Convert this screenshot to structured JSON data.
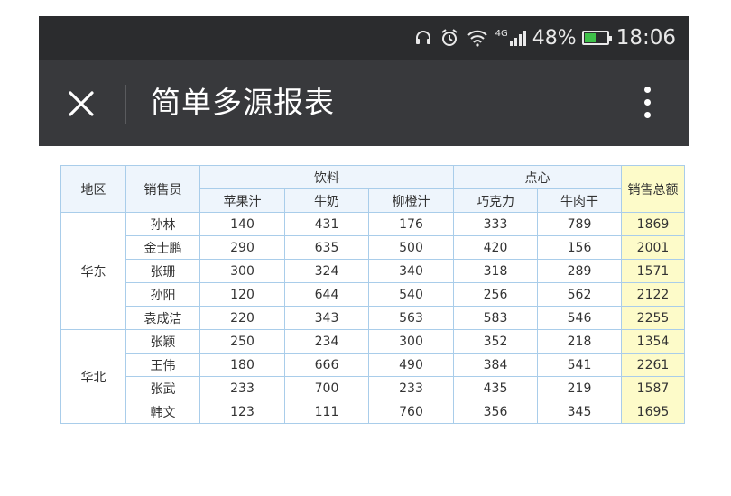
{
  "status_bar": {
    "battery_percent": "48%",
    "battery_level": 0.48,
    "network_label": "4G",
    "time": "18:06",
    "battery_color": "#3fc14a"
  },
  "app_bar": {
    "title": "简单多源报表",
    "close_icon": "close-icon",
    "more_icon": "more-vertical-icon"
  },
  "report": {
    "headers": {
      "region": "地区",
      "salesperson": "销售员",
      "group_drinks": "饮料",
      "group_snacks": "点心",
      "total": "销售总额",
      "drinks": [
        "苹果汁",
        "牛奶",
        "柳橙汁"
      ],
      "snacks": [
        "巧克力",
        "牛肉干"
      ]
    },
    "regions": [
      {
        "name": "华东",
        "rows": [
          {
            "person": "孙林",
            "values": [
              140,
              431,
              176,
              333,
              789
            ],
            "total": 1869
          },
          {
            "person": "金士鹏",
            "values": [
              290,
              635,
              500,
              420,
              156
            ],
            "total": 2001
          },
          {
            "person": "张珊",
            "values": [
              300,
              324,
              340,
              318,
              289
            ],
            "total": 1571
          },
          {
            "person": "孙阳",
            "values": [
              120,
              644,
              540,
              256,
              562
            ],
            "total": 2122
          },
          {
            "person": "袁成洁",
            "values": [
              220,
              343,
              563,
              583,
              546
            ],
            "total": 2255
          }
        ]
      },
      {
        "name": "华北",
        "rows": [
          {
            "person": "张颖",
            "values": [
              250,
              234,
              300,
              352,
              218
            ],
            "total": 1354
          },
          {
            "person": "王伟",
            "values": [
              180,
              666,
              490,
              384,
              541
            ],
            "total": 2261
          },
          {
            "person": "张武",
            "values": [
              233,
              700,
              233,
              435,
              219
            ],
            "total": 1587
          },
          {
            "person": "韩文",
            "values": [
              123,
              111,
              760,
              356,
              345
            ],
            "total": 1695
          }
        ]
      }
    ]
  }
}
